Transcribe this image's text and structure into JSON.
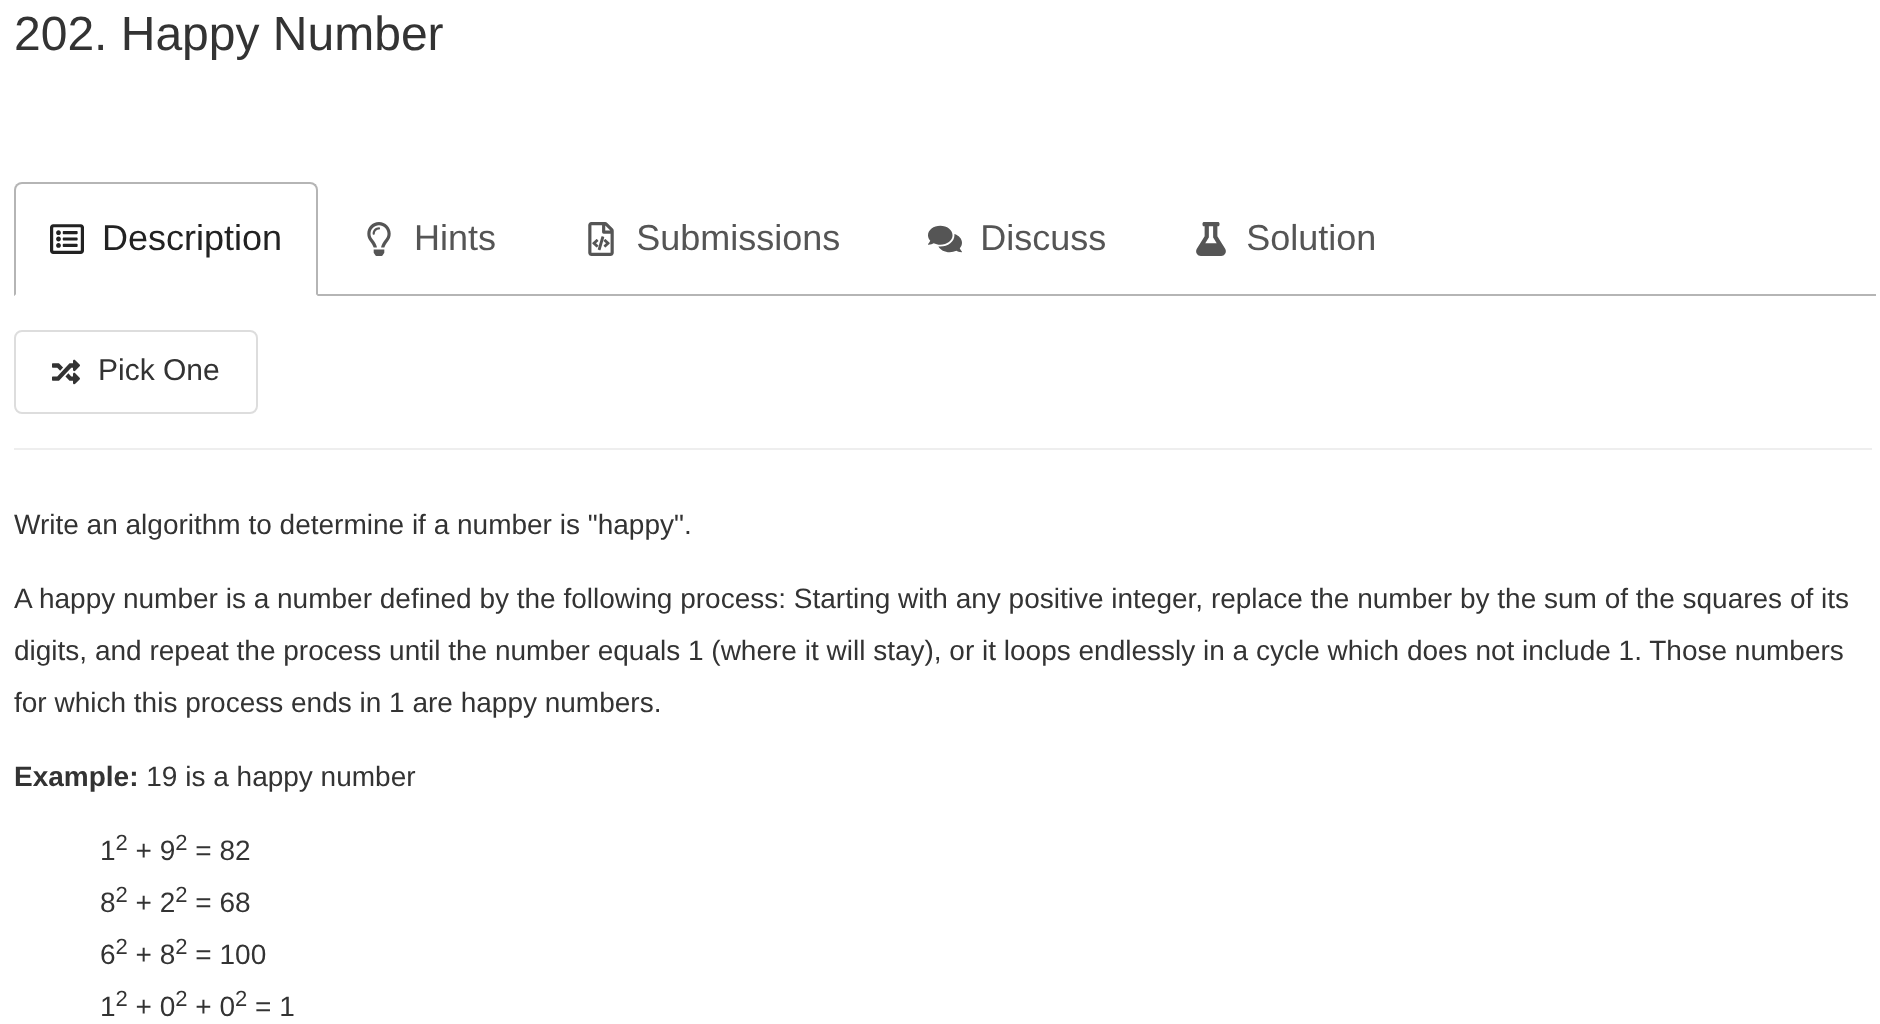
{
  "title": "202. Happy Number",
  "tabs": [
    {
      "label": "Description",
      "kind": "description",
      "selected": true
    },
    {
      "label": "Hints",
      "kind": "hints",
      "selected": false
    },
    {
      "label": "Submissions",
      "kind": "submissions",
      "selected": false
    },
    {
      "label": "Discuss",
      "kind": "discuss",
      "selected": false
    },
    {
      "label": "Solution",
      "kind": "solution",
      "selected": false
    }
  ],
  "pick_button": "Pick One",
  "paragraphs": [
    "Write an algorithm to determine if a number is \"happy\".",
    "A happy number is a number defined by the following process: Starting with any positive integer, replace the number by the sum of the squares of its digits, and repeat the process until the number equals 1 (where it will stay), or it loops endlessly in a cycle which does not include 1. Those numbers for which this process ends in 1 are happy numbers."
  ],
  "example": "**Example:** 19 is a happy number",
  "steps": [
    "1$^{2}$ + 9$^{2}$ = 82",
    "8$^{2}$ + 2$^{2}$ = 68",
    "6$^{2}$ + 8$^{2}$ = 100",
    "1$^{2}$ + 0$^{2}$ + 0$^{2}$ = 1"
  ]
}
